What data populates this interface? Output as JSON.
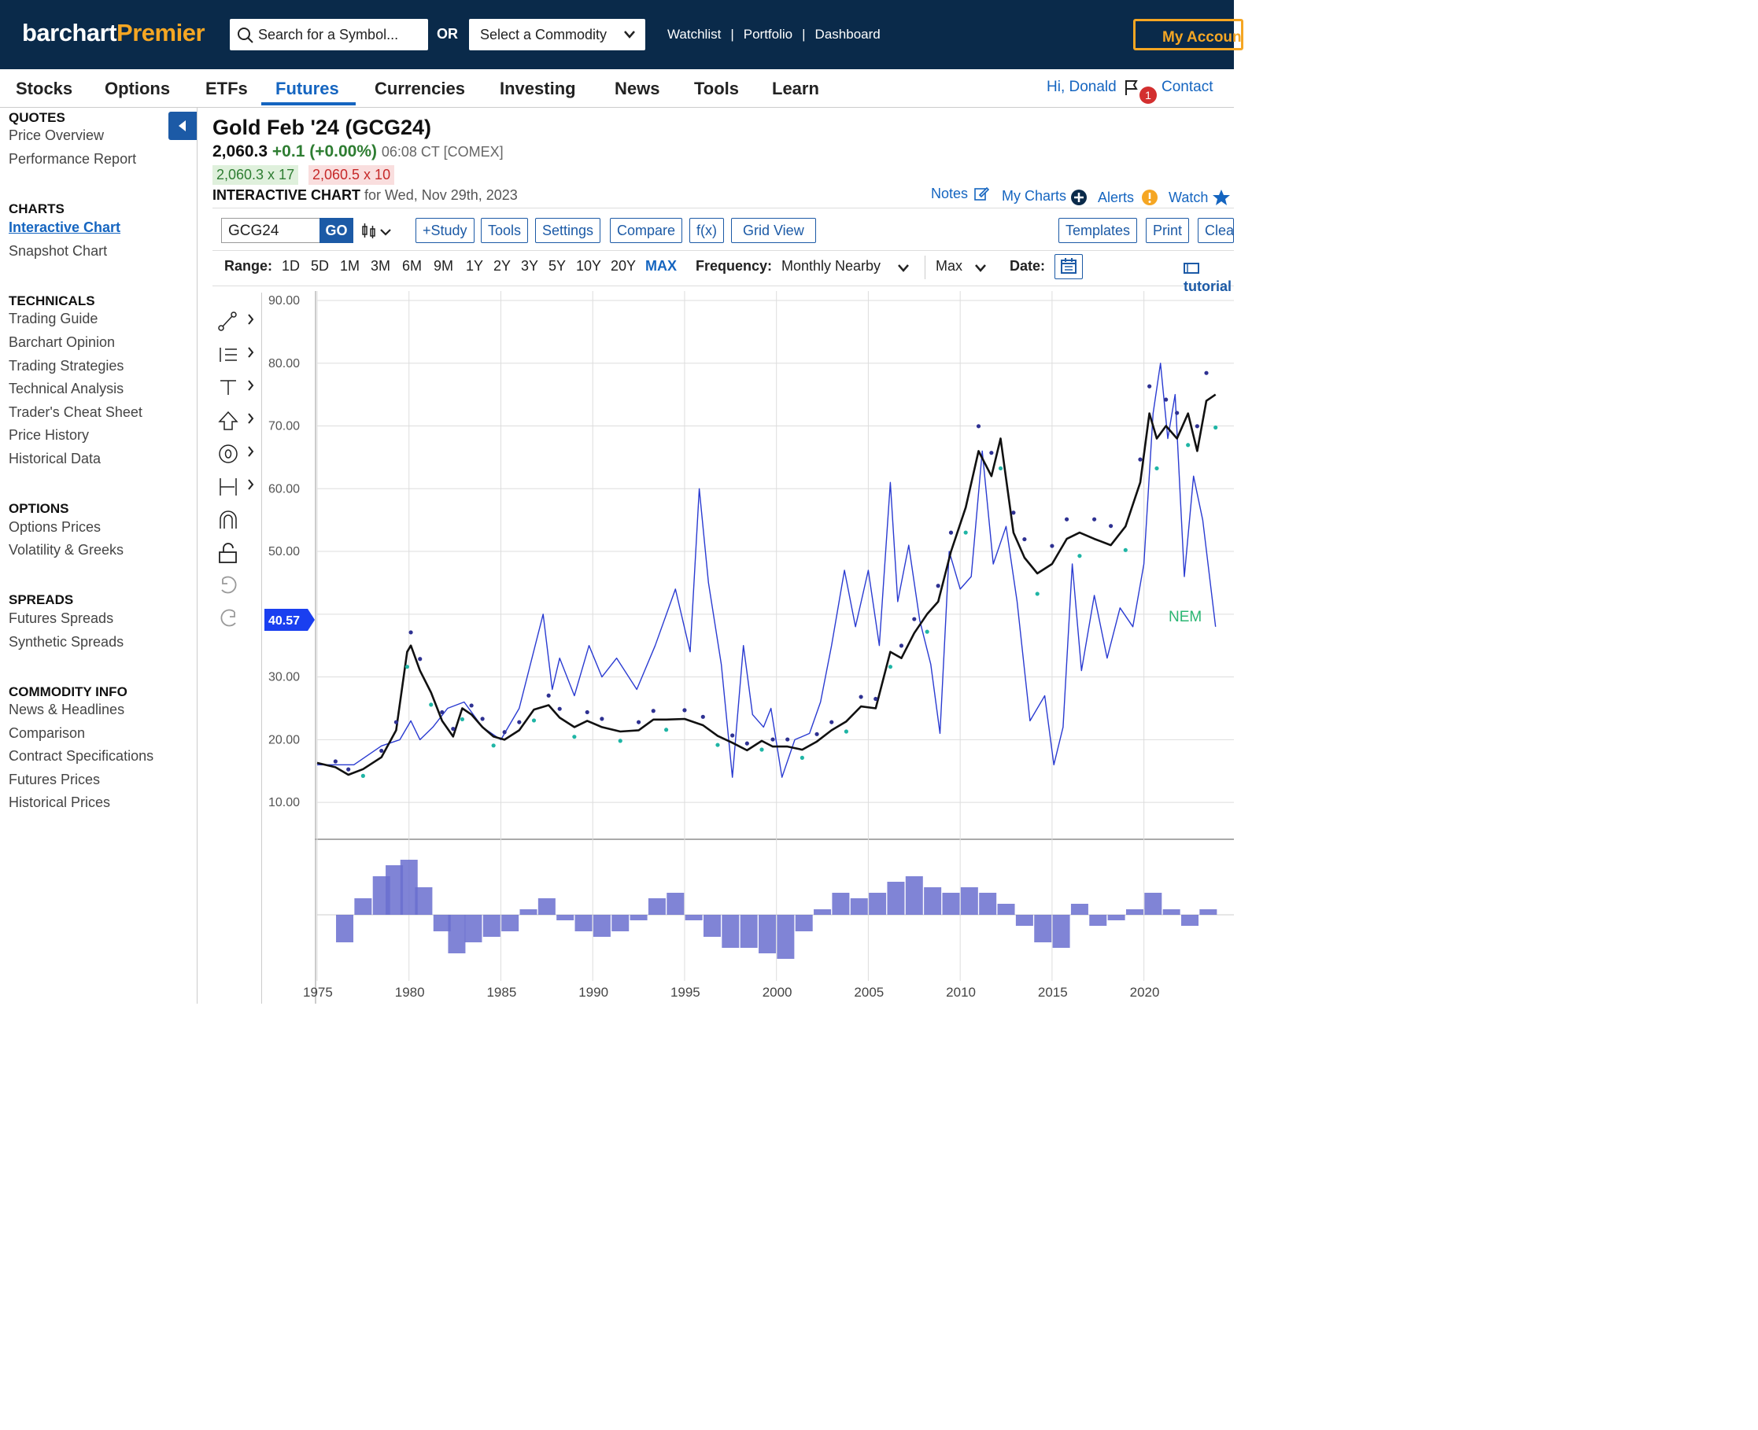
{
  "header": {
    "logo_part1": "barchart",
    "logo_part2": "Premier",
    "search_placeholder": "Search for a Symbol...",
    "or_label": "OR",
    "commodity_select": "Select a Commodity",
    "links": [
      "Watchlist",
      "Portfolio",
      "Dashboard"
    ],
    "account_button": "My Account"
  },
  "nav": {
    "items": [
      "Stocks",
      "Options",
      "ETFs",
      "Futures",
      "Currencies",
      "Investing",
      "News",
      "Tools",
      "Learn"
    ],
    "active": "Futures",
    "greeting": "Hi, Donald",
    "notification_count": "1",
    "contact": "Contact"
  },
  "sidebar": {
    "quotes_heading": "QUOTES",
    "quotes": [
      "Price Overview",
      "Performance Report"
    ],
    "charts_heading": "CHARTS",
    "charts": [
      "Interactive Chart",
      "Snapshot Chart"
    ],
    "technicals_heading": "TECHNICALS",
    "technicals": [
      "Trading Guide",
      "Barchart Opinion",
      "Trading Strategies",
      "Technical Analysis",
      "Trader's Cheat Sheet",
      "Price History",
      "Historical Data"
    ],
    "options_heading": "OPTIONS",
    "options": [
      "Options Prices",
      "Volatility & Greeks"
    ],
    "spreads_heading": "SPREADS",
    "spreads": [
      "Futures Spreads",
      "Synthetic Spreads"
    ],
    "commodity_heading": "COMMODITY INFO",
    "commodity": [
      "News & Headlines",
      "Comparison",
      "Contract Specifications",
      "Futures Prices",
      "Historical Prices"
    ]
  },
  "quote": {
    "title": "Gold Feb '24 (GCG24)",
    "last": "2,060.3",
    "change": "+0.1 (+0.00%)",
    "time": "06:08 CT [COMEX]",
    "bid": "2,060.3 x 17",
    "ask": "2,060.5 x 10",
    "chart_label": "INTERACTIVE CHART",
    "chart_date": "for Wed, Nov 29th, 2023"
  },
  "chart_links": {
    "notes": "Notes",
    "my_charts": "My Charts",
    "alerts": "Alerts",
    "watch": "Watch"
  },
  "toolbar": {
    "symbol": "GCG24",
    "go": "GO",
    "buttons": [
      "+Study",
      "Tools",
      "Settings",
      "Compare",
      "f(x)",
      "Grid View"
    ],
    "right_buttons": [
      "Templates",
      "Print",
      "Clear"
    ]
  },
  "range": {
    "label": "Range:",
    "options": [
      "1D",
      "5D",
      "1M",
      "3M",
      "6M",
      "9M",
      "1Y",
      "2Y",
      "3Y",
      "5Y",
      "10Y",
      "20Y",
      "MAX"
    ],
    "active": "MAX",
    "frequency_label": "Frequency:",
    "frequency": "Monthly Nearby",
    "max_select": "Max",
    "date_label": "Date:",
    "tutorial": "tutorial"
  },
  "chart_data": {
    "type": "line",
    "title": "",
    "price_marker": "40.57",
    "annotation": "NEM",
    "y_ticks": [
      "90.00",
      "80.00",
      "70.00",
      "60.00",
      "50.00",
      "40.00",
      "30.00",
      "20.00",
      "10.00"
    ],
    "ylim": [
      5,
      90
    ],
    "x_ticks": [
      "1975",
      "1980",
      "1985",
      "1990",
      "1995",
      "2000",
      "2005",
      "2010",
      "2015",
      "2020"
    ],
    "xlim": [
      1975,
      2023.9
    ],
    "series": [
      {
        "color": "#111111",
        "x": [
          1975,
          1976,
          1976.7,
          1977.5,
          1978.5,
          1979.3,
          1979.9,
          1980.1,
          1980.6,
          1981.2,
          1981.8,
          1982.4,
          1982.9,
          1983.4,
          1984,
          1984.6,
          1985.2,
          1986,
          1986.8,
          1987.6,
          1988.2,
          1989,
          1989.7,
          1990.5,
          1991.5,
          1992.5,
          1993.3,
          1994,
          1995,
          1996,
          1996.8,
          1997.6,
          1998.4,
          1999.2,
          1999.8,
          2000.6,
          2001.4,
          2002.2,
          2003,
          2003.8,
          2004.6,
          2005.4,
          2006.2,
          2006.8,
          2007.5,
          2008.2,
          2008.8,
          2009.5,
          2010.3,
          2011,
          2011.7,
          2012.2,
          2012.9,
          2013.5,
          2014.2,
          2015,
          2015.8,
          2016.5,
          2017.3,
          2018.2,
          2019,
          2019.8,
          2020.3,
          2020.7,
          2021.2,
          2021.8,
          2022.4,
          2022.9,
          2023.4,
          2023.9
        ],
        "y": [
          16.3,
          15.6,
          14.4,
          15.3,
          17.2,
          21.5,
          34,
          35,
          31,
          27.5,
          23,
          20.5,
          25,
          24,
          22,
          20.5,
          20,
          21.5,
          24.8,
          25.5,
          23.5,
          22,
          23,
          22,
          21.3,
          21.5,
          23.2,
          23.2,
          23.3,
          22.3,
          20.6,
          19.5,
          18.3,
          19.8,
          18.9,
          18.9,
          18.4,
          19.7,
          21.5,
          22.9,
          25.3,
          25,
          34,
          33,
          37,
          40,
          42,
          50,
          57,
          66,
          62,
          68,
          53,
          49,
          46.5,
          48,
          52,
          53,
          52,
          51,
          54,
          61,
          72,
          68,
          70,
          68,
          72,
          66,
          74,
          75
        ]
      },
      {
        "color": "#2a3bd1",
        "x": [
          1975,
          1977,
          1978.5,
          1979.5,
          1980.1,
          1980.6,
          1981.3,
          1982.1,
          1983,
          1984,
          1985,
          1986,
          1987.3,
          1987.8,
          1988.2,
          1989,
          1989.8,
          1990.5,
          1991.3,
          1992.4,
          1993.4,
          1994.5,
          1995.3,
          1995.8,
          1996.3,
          1997,
          1997.6,
          1998.2,
          1998.7,
          1999.3,
          1999.7,
          2000.3,
          2001,
          2001.8,
          2002.4,
          2003,
          2003.7,
          2004.3,
          2005,
          2005.6,
          2006.2,
          2006.6,
          2007.2,
          2007.8,
          2008.4,
          2008.9,
          2009.4,
          2010,
          2010.6,
          2011.2,
          2011.8,
          2012.5,
          2013.1,
          2013.8,
          2014.6,
          2015.1,
          2015.6,
          2016.1,
          2016.6,
          2017.3,
          2018,
          2018.7,
          2019.4,
          2020,
          2020.5,
          2020.9,
          2021.3,
          2021.7,
          2022.2,
          2022.7,
          2023.2,
          2023.9
        ],
        "y": [
          16,
          16,
          19,
          20,
          23,
          20,
          22,
          25,
          26,
          22,
          20,
          25,
          40,
          28,
          33,
          27,
          35,
          30,
          33,
          28,
          35,
          44,
          34,
          60,
          45,
          32,
          14,
          35,
          24,
          22,
          25,
          14,
          20,
          21,
          26,
          35,
          47,
          38,
          47,
          35,
          61,
          42,
          51,
          39,
          32,
          21,
          50,
          44,
          46,
          66,
          48,
          54,
          42,
          23,
          27,
          16,
          22,
          48,
          31,
          43,
          33,
          41,
          38,
          48,
          72,
          80,
          68,
          75,
          46,
          62,
          55,
          38
        ]
      }
    ],
    "volume_histogram": {
      "x": [
        1976.5,
        1977.5,
        1978.5,
        1979.2,
        1980,
        1980.8,
        1981.8,
        1982.6,
        1983.5,
        1984.5,
        1985.5,
        1986.5,
        1987.5,
        1988.5,
        1989.5,
        1990.5,
        1991.5,
        1992.5,
        1993.5,
        1994.5,
        1995.5,
        1996.5,
        1997.5,
        1998.5,
        1999.5,
        2000.5,
        2001.5,
        2002.5,
        2003.5,
        2004.5,
        2005.5,
        2006.5,
        2007.5,
        2008.5,
        2009.5,
        2010.5,
        2011.5,
        2012.5,
        2013.5,
        2014.5,
        2015.5,
        2016.5,
        2017.5,
        2018.5,
        2019.5,
        2020.5,
        2021.5,
        2022.5,
        2023.5
      ],
      "values": [
        -0.5,
        0.3,
        0.7,
        0.9,
        1.0,
        0.5,
        -0.3,
        -0.7,
        -0.5,
        -0.4,
        -0.3,
        0.1,
        0.3,
        -0.1,
        -0.3,
        -0.4,
        -0.3,
        -0.1,
        0.3,
        0.4,
        -0.1,
        -0.4,
        -0.6,
        -0.6,
        -0.7,
        -0.8,
        -0.3,
        0.1,
        0.4,
        0.3,
        0.4,
        0.6,
        0.7,
        0.5,
        0.4,
        0.5,
        0.4,
        0.2,
        -0.2,
        -0.5,
        -0.6,
        0.2,
        -0.2,
        -0.1,
        0.1,
        0.4,
        0.1,
        -0.2,
        0.1
      ]
    }
  }
}
